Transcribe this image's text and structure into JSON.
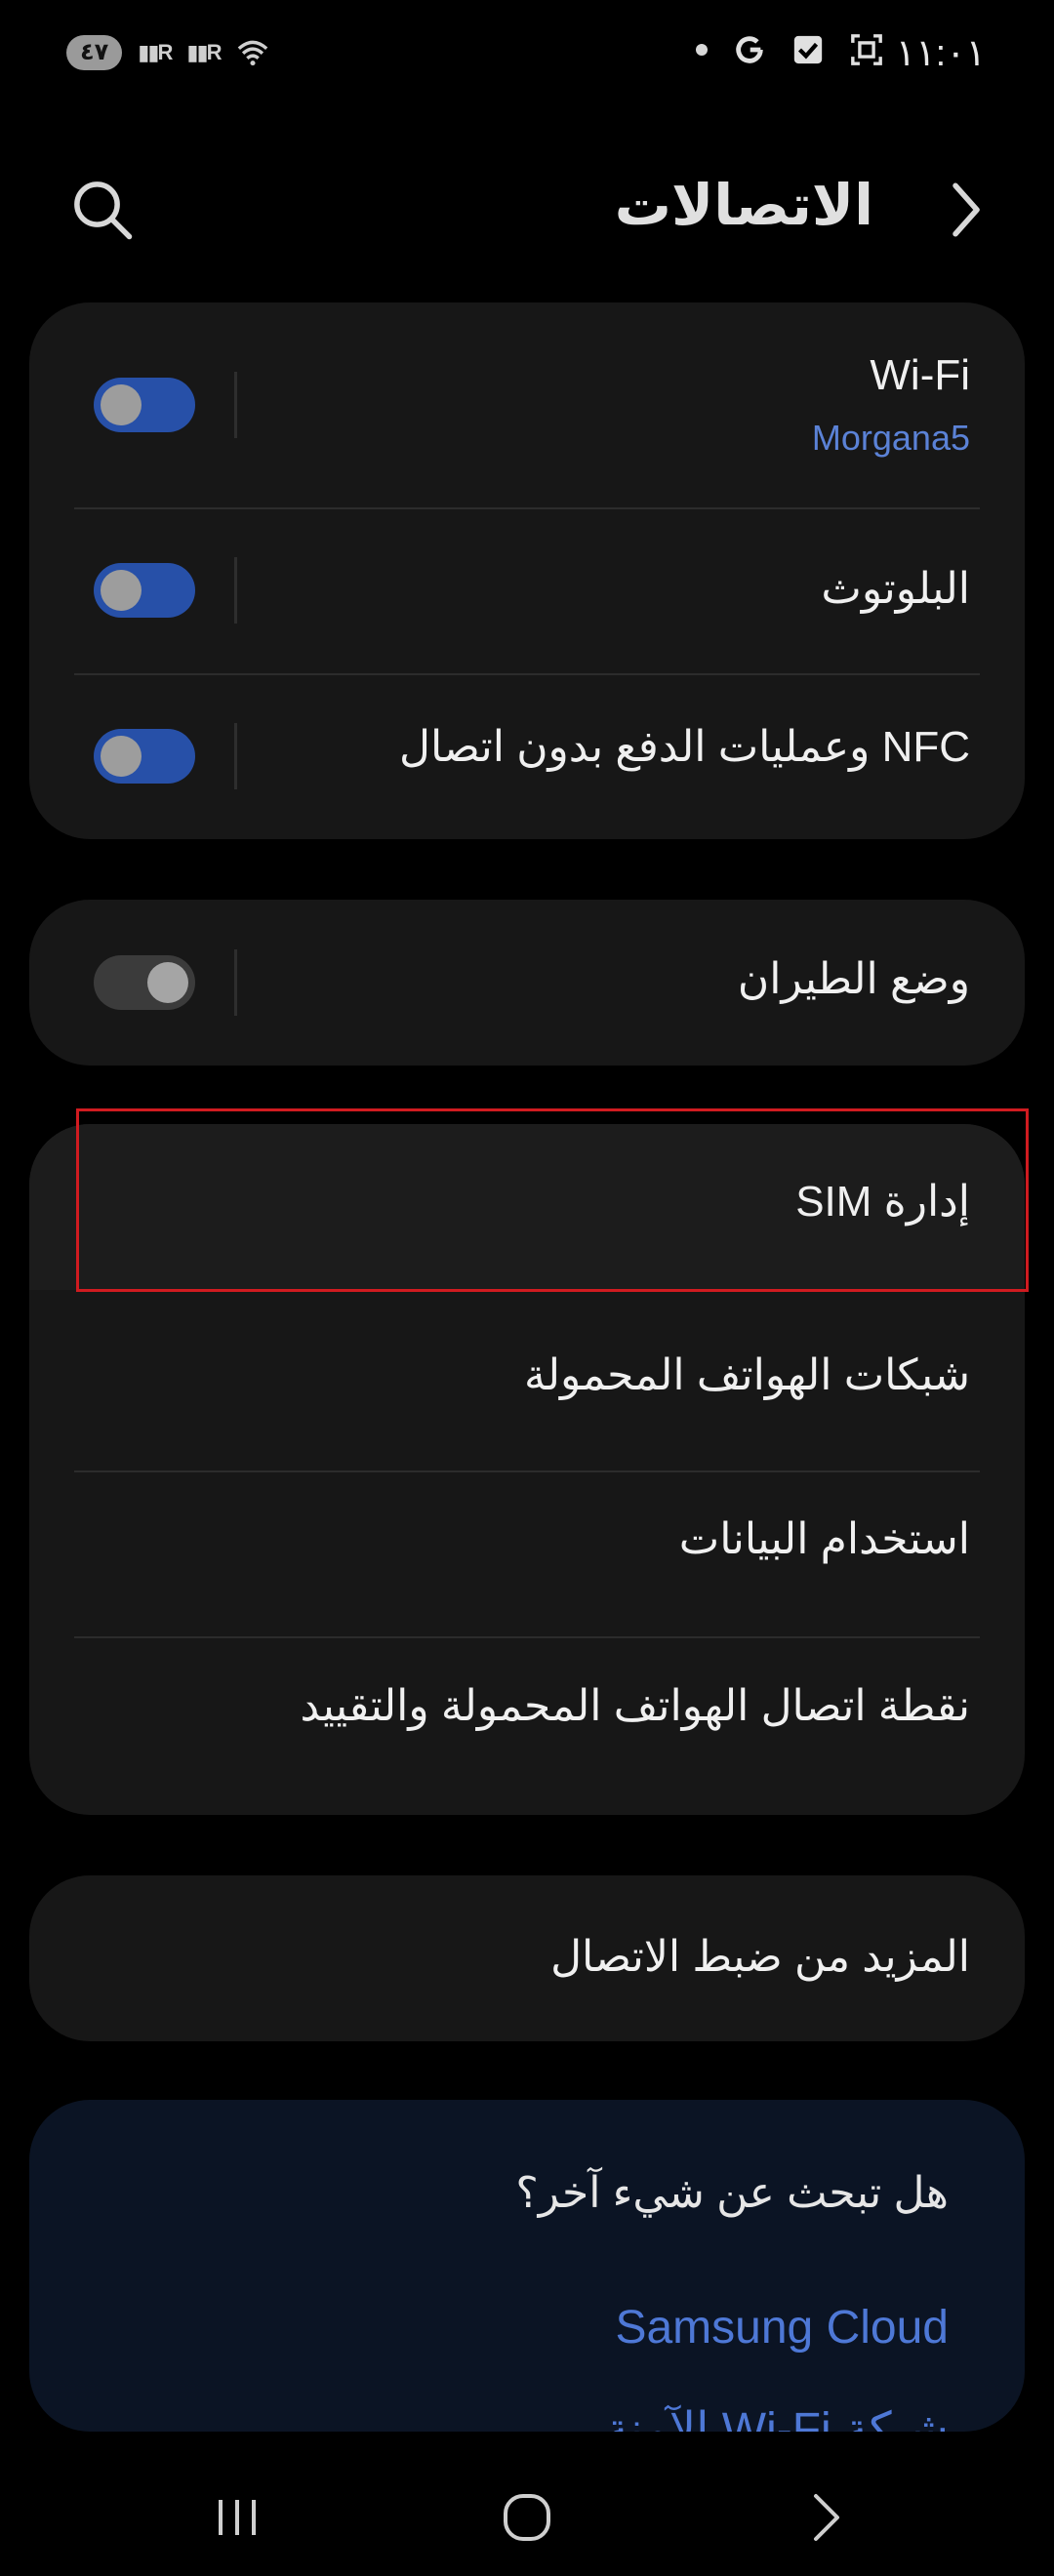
{
  "status_bar": {
    "time": "١١:٠١",
    "battery": "٤٧",
    "signal_1": "R",
    "signal_2": "R",
    "icons": [
      "dot-icon",
      "google-icon",
      "checkbox-icon",
      "screenshot-icon",
      "wifi-icon"
    ]
  },
  "header": {
    "title": "الاتصالات"
  },
  "group1": {
    "wifi": {
      "label": "Wi-Fi",
      "network": "Morgana5",
      "enabled": true
    },
    "bluetooth": {
      "label": "البلوتوث",
      "enabled": true
    },
    "nfc": {
      "label": "NFC وعمليات الدفع بدون اتصال",
      "enabled": true
    }
  },
  "group2": {
    "airplane": {
      "label": "وضع الطيران",
      "enabled": false
    }
  },
  "group3": {
    "sim": {
      "label": "إدارة SIM"
    },
    "mobile_networks": {
      "label": "شبكات الهواتف المحمولة"
    },
    "data_usage": {
      "label": "استخدام البيانات"
    },
    "hotspot": {
      "label": "نقطة اتصال الهواتف المحمولة والتقييد"
    }
  },
  "group4": {
    "more": {
      "label": "المزيد من ضبط الاتصال"
    }
  },
  "suggestions": {
    "title": "هل تبحث عن شيء آخر؟",
    "links": [
      "Samsung Cloud",
      "شبكة Wi-Fi الآمنة"
    ]
  },
  "colors": {
    "accent": "#5b82d6",
    "toggle_on": "#2750a8",
    "highlight": "#d01b20",
    "card": "#171717"
  }
}
